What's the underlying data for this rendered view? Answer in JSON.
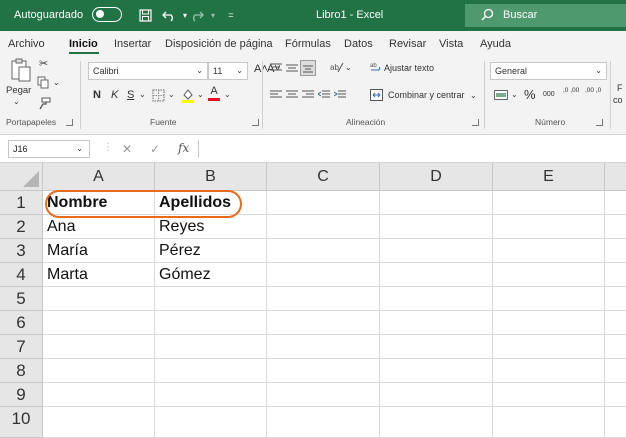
{
  "titlebar": {
    "autosave_label": "Autoguardado",
    "document_title": "Libro1 - Excel",
    "search_placeholder": "Buscar"
  },
  "menu": {
    "items": [
      "Archivo",
      "Inicio",
      "Insertar",
      "Disposición de página",
      "Fórmulas",
      "Datos",
      "Revisar",
      "Vista",
      "Ayuda"
    ],
    "active": "Inicio"
  },
  "ribbon": {
    "paste_label": "Pegar",
    "font_name": "Calibri",
    "font_size": "11",
    "bold_btn": "N",
    "italic_btn": "K",
    "underline_btn": "S",
    "grow_font": "A˄",
    "shrink_font": "A˅",
    "font_color_btn": "A",
    "wrap_text": "Ajustar texto",
    "merge_center": "Combinar y centrar",
    "number_format": "General",
    "percent_btn": "%",
    "thousands_btn": "000",
    "inc_decimal": ",0 ,00",
    "dec_decimal": ",00 ,0",
    "partial_right": "F",
    "partial_right_2": "co",
    "groups": {
      "clipboard": "Portapapeles",
      "font": "Fuente",
      "alignment": "Alineación",
      "number": "Número"
    }
  },
  "formula_bar": {
    "name_box": "J16",
    "fx": "fx",
    "value": ""
  },
  "sheet": {
    "columns": [
      "A",
      "B",
      "C",
      "D",
      "E"
    ],
    "rows": [
      "1",
      "2",
      "3",
      "4",
      "5",
      "6",
      "7",
      "8",
      "9",
      "10"
    ],
    "cells": {
      "A1": "Nombre",
      "B1": "Apellidos",
      "A2": "Ana",
      "B2": "Reyes",
      "A3": "María",
      "B3": "Pérez",
      "A4": "Marta",
      "B4": "Gómez"
    }
  },
  "colors": {
    "excel_green": "#217346",
    "highlight_oval": "#e86a1c"
  }
}
